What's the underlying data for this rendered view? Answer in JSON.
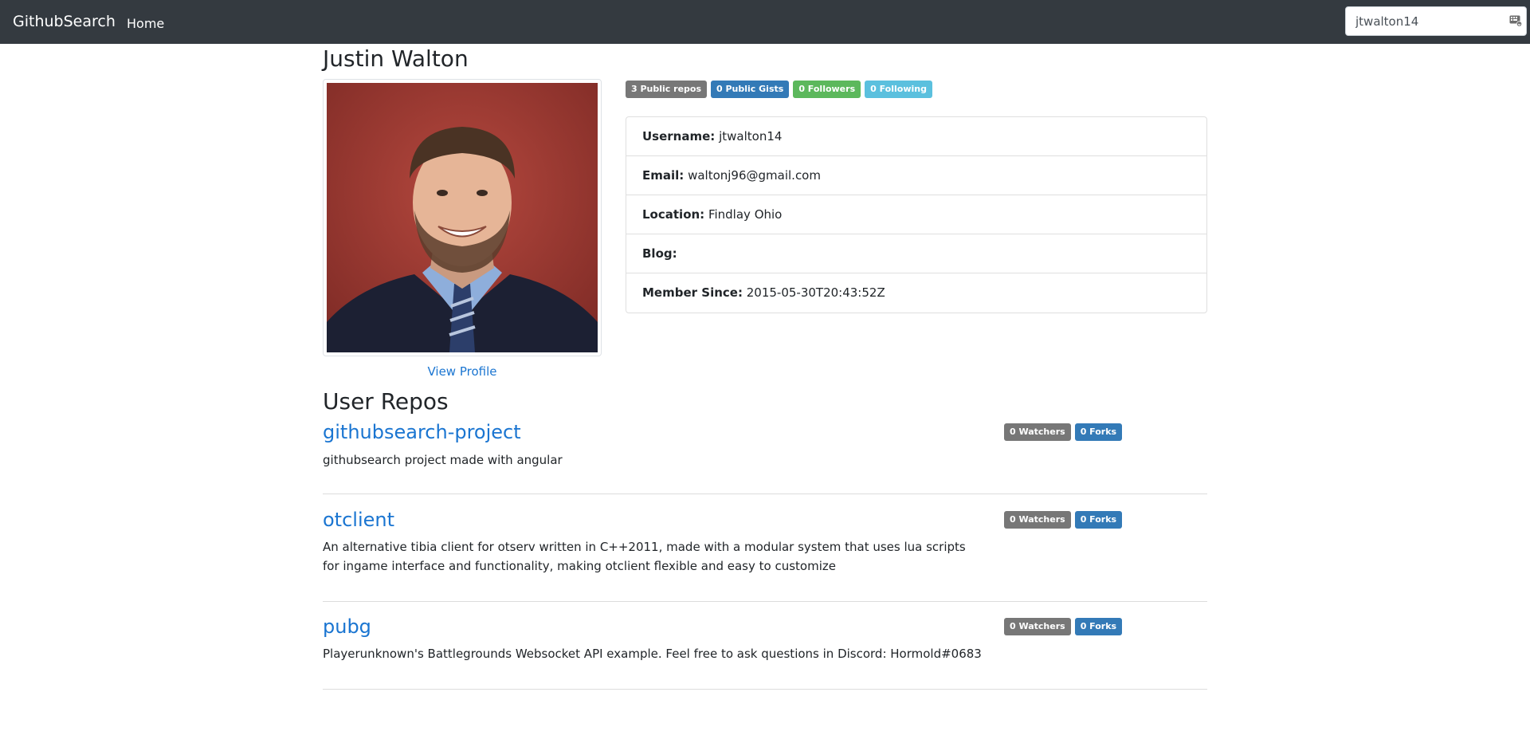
{
  "navbar": {
    "brand": "GithubSearch",
    "home": "Home",
    "search_value": "jtwalton14",
    "search_icon": "keyboard-icon"
  },
  "profile": {
    "name": "Justin Walton",
    "avatar_alt": "avatar",
    "view_profile": "View Profile",
    "badges": {
      "repos": "3 Public repos",
      "gists": "0 Public Gists",
      "followers": "0 Followers",
      "following": "0 Following"
    },
    "fields": {
      "username_label": "Username:",
      "username": "jtwalton14",
      "email_label": "Email:",
      "email": "waltonj96@gmail.com",
      "location_label": "Location:",
      "location": "Findlay Ohio",
      "blog_label": "Blog:",
      "blog": "",
      "member_label": "Member Since:",
      "member": "2015-05-30T20:43:52Z"
    }
  },
  "repos": {
    "title": "User Repos",
    "items": [
      {
        "name": "githubsearch-project",
        "description": "githubsearch project made with angular",
        "watchers": "0 Watchers",
        "forks": "0 Forks"
      },
      {
        "name": "otclient",
        "description": "An alternative tibia client for otserv written in C++2011, made with a modular system that uses lua scripts for ingame interface and functionality, making otclient flexible and easy to customize",
        "watchers": "0 Watchers",
        "forks": "0 Forks"
      },
      {
        "name": "pubg",
        "description": "Playerunknown's Battlegrounds Websocket API example. Feel free to ask questions in Discord: Hormold#0683",
        "watchers": "0 Watchers",
        "forks": "0 Forks"
      }
    ]
  },
  "colors": {
    "navbar_bg": "#343a40",
    "link": "#1a75d1",
    "badge_gray": "#777777",
    "badge_blue": "#337ab7",
    "badge_green": "#5cb85c",
    "badge_cyan": "#5bc0de"
  }
}
